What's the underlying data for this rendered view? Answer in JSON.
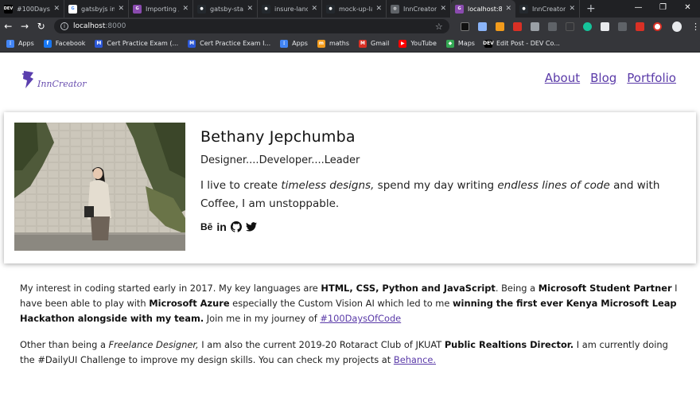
{
  "tabs": [
    {
      "title": "#100DaysO",
      "icon": "dev-icon",
      "color": "#000000",
      "glyph": "DEV"
    },
    {
      "title": "gatsbyjs im",
      "icon": "google-icon",
      "color": "#ffffff",
      "glyph": "G"
    },
    {
      "title": "Importing /",
      "icon": "gatsby-icon",
      "color": "#8a4baf",
      "glyph": "G"
    },
    {
      "title": "gatsby-star",
      "icon": "github-icon",
      "color": "#24292e",
      "glyph": "●"
    },
    {
      "title": "insure-land",
      "icon": "github-icon",
      "color": "#24292e",
      "glyph": "●"
    },
    {
      "title": "mock-up-la",
      "icon": "github-icon",
      "color": "#24292e",
      "glyph": "●"
    },
    {
      "title": "InnCreator",
      "icon": "globe-icon",
      "color": "#5f6368",
      "glyph": "◍"
    },
    {
      "title": "localhost:8",
      "icon": "gatsby-icon",
      "color": "#8a4baf",
      "glyph": "G",
      "active": true
    },
    {
      "title": "InnCreator",
      "icon": "github-icon",
      "color": "#24292e",
      "glyph": "●"
    }
  ],
  "address": {
    "host": "localhost",
    "port": ":8000"
  },
  "bookmarks": [
    {
      "label": "Apps",
      "icon": "apps-grid-icon",
      "color": "#4285f4",
      "glyph": "⋮"
    },
    {
      "label": "Facebook",
      "icon": "facebook-icon",
      "color": "#1877f2",
      "glyph": "f"
    },
    {
      "label": "Cert Practice Exam (...",
      "icon": "microsoft-icon",
      "color": "#2b57d6",
      "glyph": "M"
    },
    {
      "label": "Cert Practice Exam I...",
      "icon": "microsoft-icon",
      "color": "#2b57d6",
      "glyph": "M"
    },
    {
      "label": "Apps",
      "icon": "apps-grid-icon",
      "color": "#4285f4",
      "glyph": "⋮"
    },
    {
      "label": "maths",
      "icon": "maths-icon",
      "color": "#f29b1c",
      "glyph": "m"
    },
    {
      "label": "Gmail",
      "icon": "gmail-icon",
      "color": "#d93025",
      "glyph": "M"
    },
    {
      "label": "YouTube",
      "icon": "youtube-icon",
      "color": "#ff0000",
      "glyph": "▶"
    },
    {
      "label": "Maps",
      "icon": "maps-icon",
      "color": "#34a853",
      "glyph": "◆"
    },
    {
      "label": "Edit Post - DEV Co...",
      "icon": "dev-icon",
      "color": "#000000",
      "glyph": "DEV"
    }
  ],
  "site": {
    "logo_text": "InnCreator",
    "nav": [
      "About",
      "Blog",
      "Portfolio"
    ]
  },
  "profile": {
    "name": "Bethany Jepchumba",
    "tagline": "Designer....Developer....Leader",
    "desc_1": "I live to create ",
    "desc_em1": "timeless designs,",
    "desc_2": " spend my day writing ",
    "desc_em2": "endless lines of code",
    "desc_3": " and with Coffee, I am unstoppable.",
    "socials": [
      "behance-icon",
      "linkedin-icon",
      "github-icon",
      "twitter-icon"
    ]
  },
  "about": {
    "p1_a": "My interest in coding started early in 2017. My key languages are ",
    "p1_b": "HTML, CSS, Python and JavaScript",
    "p1_c": ". Being a ",
    "p1_d": "Microsoft Student Partner",
    "p1_e": " I have been able to play with ",
    "p1_f": "Microsoft Azure",
    "p1_g": " especially the Custom Vision AI which led to me ",
    "p1_h": "winning the first ever Kenya Microsoft Leap Hackathon alongside with my team.",
    "p1_i": " Join me in my journey of ",
    "p1_link": "#100DaysOfCode",
    "p2_a": "Other than being a ",
    "p2_b": "Freelance Designer,",
    "p2_c": " I am also the current 2019-20 Rotaract Club of JKUAT ",
    "p2_d": "Public Realtions Director.",
    "p2_e": " I am currently doing the #DailyUI Challenge to improve my design skills. You can check my projects at ",
    "p2_link": "Behance."
  }
}
